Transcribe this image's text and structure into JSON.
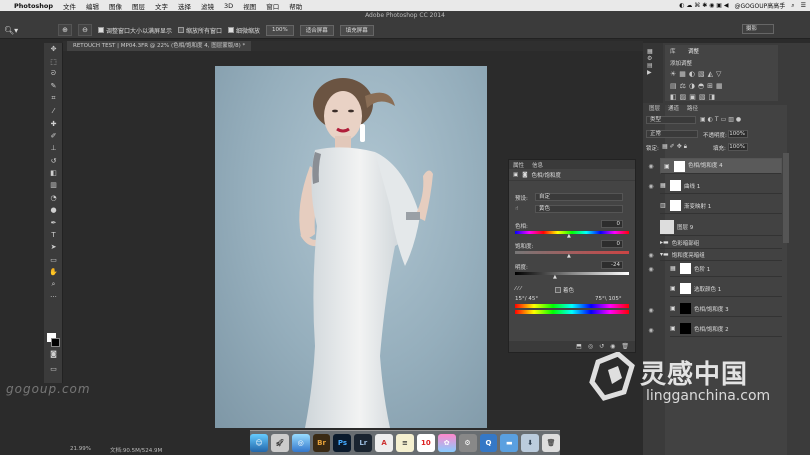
{
  "menubar": {
    "app": "Photoshop",
    "items": [
      "文件",
      "编辑",
      "图像",
      "图层",
      "文字",
      "选择",
      "滤镜",
      "3D",
      "视图",
      "窗口",
      "帮助"
    ],
    "right_user": "@GOGOUP高高手"
  },
  "window_title": "Adobe Photoshop CC 2014",
  "options": {
    "check_resize": "调整窗口大小以满屏显示",
    "check_zoom_all": "缩放所有窗口",
    "check_scrubby": "细微缩放",
    "btn_100": "100%",
    "btn_fit": "适合屏幕",
    "btn_fill": "填充屏幕",
    "workspace": "摄影"
  },
  "document_tab": "RETOUCH TEST | MP04.3FR @ 22% (色相/饱和度 4, 图层蒙版/8) *",
  "status": {
    "zoom": "21.99%",
    "doc": "文档:90.5M/524.9M"
  },
  "properties": {
    "tab1": "属性",
    "tab2": "信息",
    "title": "色相/饱和度",
    "preset_label": "预设:",
    "preset_value": "自定",
    "channel": "黄色",
    "hue_label": "色相:",
    "hue_value": "0",
    "sat_label": "饱和度:",
    "sat_value": "0",
    "light_label": "明度:",
    "light_value": "-24",
    "colorize": "着色",
    "range_left": "15°/ 45°",
    "range_right": "75°\\ 105°"
  },
  "adjust_panel": {
    "tab1": "库",
    "tab2": "调整",
    "title": "添加调整"
  },
  "layers_panel": {
    "tabs": [
      "图层",
      "通道",
      "路径"
    ],
    "filter": "类型",
    "blend": "正常",
    "opacity_label": "不透明度:",
    "opacity": "100%",
    "lock_label": "锁定:",
    "fill_label": "填充:",
    "fill": "100%",
    "layers": [
      {
        "name": "色相/饱和度 4",
        "selected": true,
        "thumb": "#ffffff"
      },
      {
        "name": "曲线 1",
        "selected": false,
        "thumb": "#ffffff"
      },
      {
        "name": "渐变映射 1",
        "selected": false,
        "thumb": "#ffffff"
      },
      {
        "name": "图层 9",
        "selected": false,
        "thumb": "#dddddd"
      },
      {
        "name": "色彩暗部组",
        "selected": false,
        "thumb": ""
      },
      {
        "name": "饱和度亮暗组",
        "selected": false,
        "thumb": ""
      },
      {
        "name": "色阶 1",
        "selected": false,
        "thumb": "#ffffff"
      },
      {
        "name": "选取颜色 1",
        "selected": false,
        "thumb": "#ffffff"
      },
      {
        "name": "色相/饱和度 3",
        "selected": false,
        "thumb": "#000000"
      },
      {
        "name": "色相/饱和度 2",
        "selected": false,
        "thumb": "#000000"
      }
    ]
  },
  "watermark": {
    "left": "gogoup.com",
    "brand": "灵感中国",
    "url": "lingganchina.com"
  },
  "dock_labels": [
    "Br",
    "Ps",
    "Lr"
  ],
  "colors": {
    "accent": "#5a5a5a",
    "panel": "#3b3b3b"
  }
}
